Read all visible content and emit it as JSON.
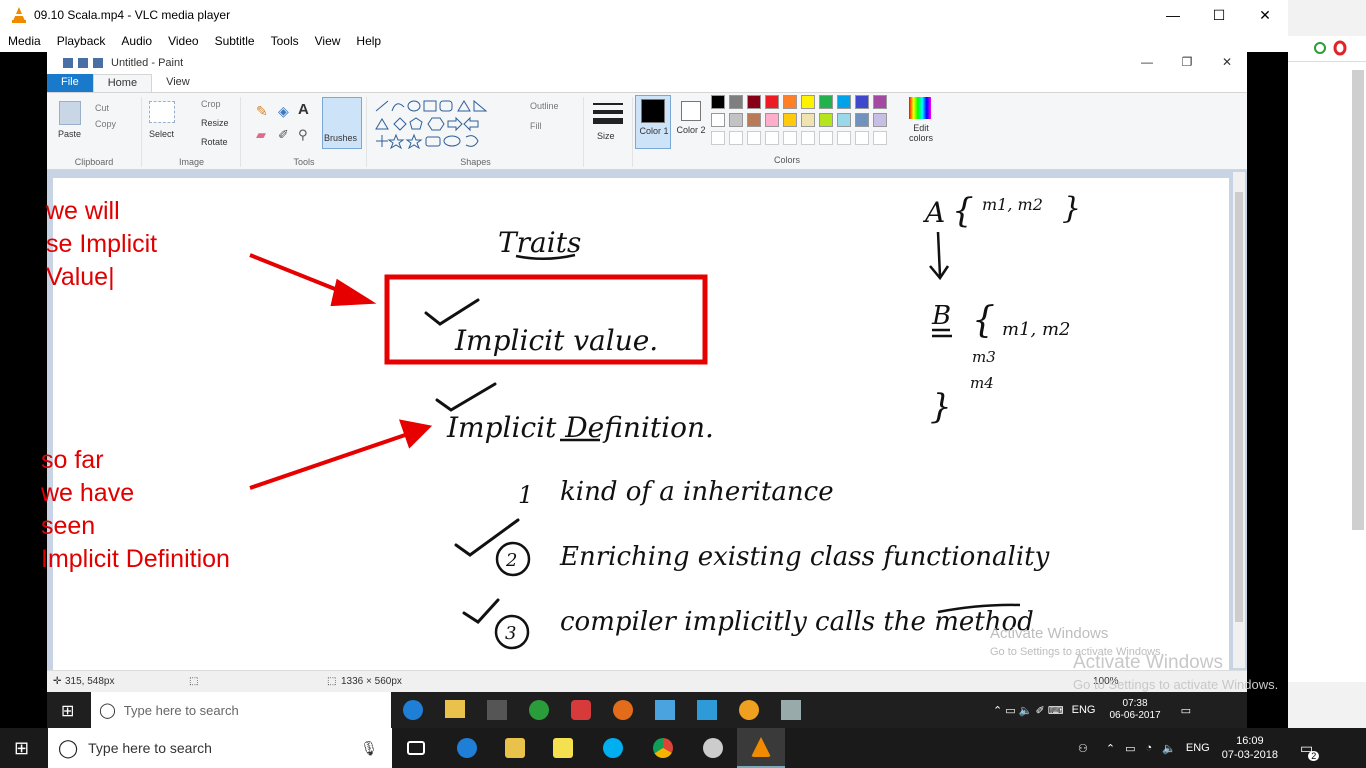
{
  "vlc": {
    "title": "09.10  Scala.mp4 - VLC media player",
    "menu": [
      "Media",
      "Playback",
      "Audio",
      "Video",
      "Subtitle",
      "Tools",
      "View",
      "Help"
    ]
  },
  "paint": {
    "title": "Untitled - Paint",
    "tabs": [
      "File",
      "Home",
      "View"
    ],
    "clipboard": {
      "paste": "Paste",
      "cut": "Cut",
      "copy": "Copy",
      "label": "Clipboard"
    },
    "image": {
      "select": "Select",
      "crop": "Crop",
      "resize": "Resize",
      "rotate": "Rotate",
      "label": "Image"
    },
    "tools": {
      "label": "Tools",
      "brushes": "Brushes"
    },
    "shapes": {
      "outline": "Outline",
      "fill": "Fill",
      "label": "Shapes"
    },
    "size": "Size",
    "color1": "Color 1",
    "color2": "Color 2",
    "colors_label": "Colors",
    "edit_colors": "Edit colors",
    "status": {
      "pos": "315, 548px",
      "size": "1336 × 560px",
      "zoom": "100%"
    },
    "colors": {
      "row1": [
        "#000000",
        "#7f7f7f",
        "#880015",
        "#ed1c24",
        "#ff7f27",
        "#fff200",
        "#22b14c",
        "#00a2e8",
        "#3f48cc",
        "#a349a4"
      ],
      "row2": [
        "#ffffff",
        "#c3c3c3",
        "#b97a57",
        "#ffaec9",
        "#ffc90e",
        "#efe4b0",
        "#b5e61d",
        "#99d9ea",
        "#7092be",
        "#c8bfe7"
      ]
    }
  },
  "notes": {
    "left_top": [
      "we will",
      "se Implicit",
      "Value|"
    ],
    "left_bottom": [
      "so far",
      "we have",
      "seen",
      "Implicit Definition"
    ]
  },
  "handwriting": {
    "heading": "Traits",
    "item1": "Implicit value.",
    "item2": "Implicit   Definition.",
    "point1": "kind of a inheritance",
    "point2": "Enriching existing class functionality",
    "point3": "compiler implicitly calls the method",
    "a_label": "A",
    "a_body": "m1, m2",
    "b_label": "B",
    "b_body": "m1, m2",
    "m3": "m3",
    "m4": "m4",
    "num1": "1",
    "num2": "2",
    "num3": "3"
  },
  "watermarks": {
    "inner_title": "Activate Windows",
    "inner_sub": "Go to Settings to activate Windows.",
    "outer_title": "Activate Windows",
    "outer_sub": "Go to Settings to activate Windows."
  },
  "inner_taskbar": {
    "search_placeholder": "Type here to search",
    "lang": "ENG",
    "time": "07:38",
    "date": "06-06-2017"
  },
  "taskbar": {
    "search_placeholder": "Type here to search",
    "lang": "ENG",
    "time": "16:09",
    "date": "07-03-2018",
    "notifications": "2"
  }
}
